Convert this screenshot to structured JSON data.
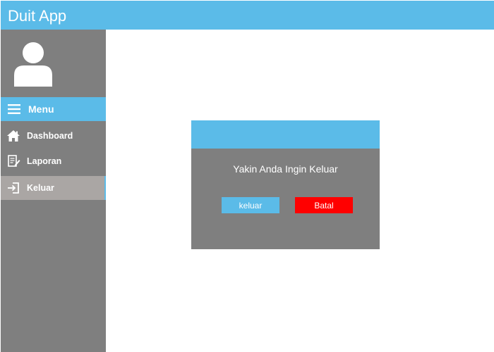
{
  "app": {
    "title": "Duit App"
  },
  "sidebar": {
    "menu_label": "Menu",
    "items": [
      {
        "label": "Dashboard",
        "icon": "home-icon"
      },
      {
        "label": "Laporan",
        "icon": "report-icon"
      },
      {
        "label": "Keluar",
        "icon": "logout-icon",
        "active": true
      }
    ]
  },
  "dialog": {
    "message": "Yakin Anda Ingin Keluar",
    "confirm_label": "keluar",
    "cancel_label": "Batal"
  },
  "colors": {
    "accent": "#5bbbe8",
    "sidebar_bg": "#7f7f7f",
    "active_item_bg": "#aaa6a4",
    "danger": "#ff0000"
  }
}
